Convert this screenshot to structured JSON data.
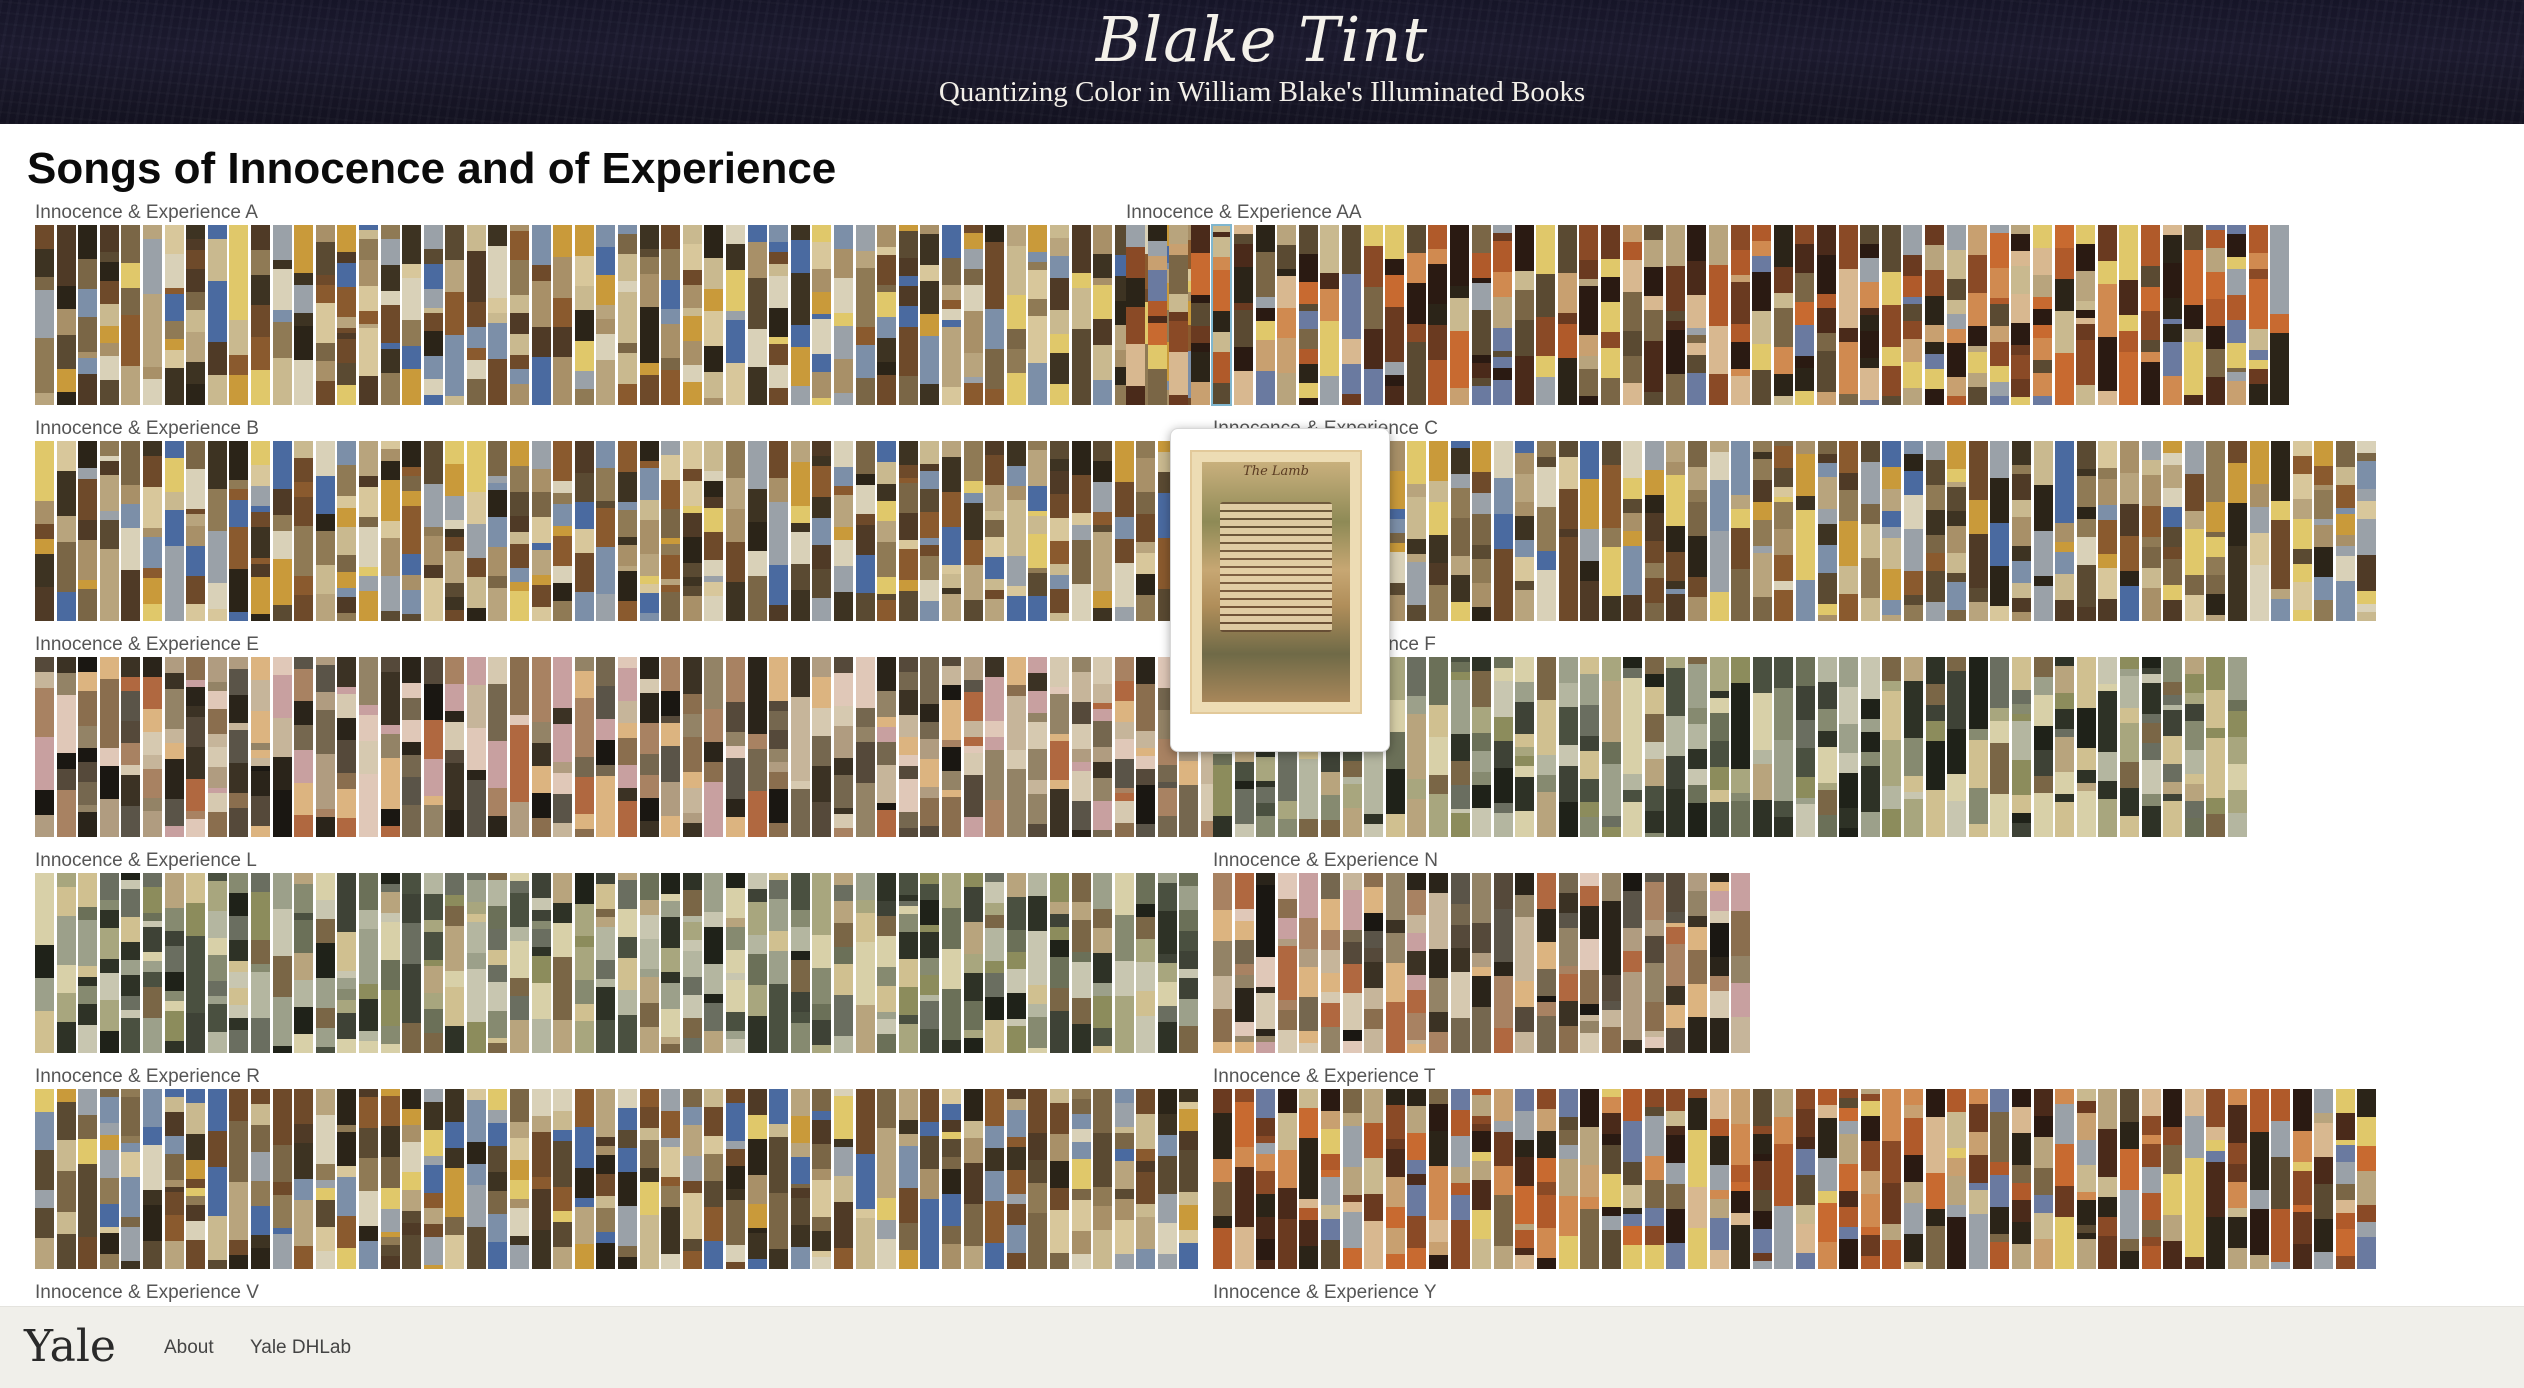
{
  "site": {
    "logo": "Blake Tint",
    "subtitle": "Quantizing Color in William Blake's Illuminated Books"
  },
  "page": {
    "title": "Songs of Innocence and of Experience"
  },
  "copies": [
    {
      "label": "Innocence & Experience A",
      "plates": 54
    },
    {
      "label": "Innocence & Experience AA",
      "plates": 54
    },
    {
      "label": "Innocence & Experience B",
      "plates": 54
    },
    {
      "label": "Innocence & Experience C",
      "plates": 54
    },
    {
      "label": "Innocence & Experience E",
      "plates": 55
    },
    {
      "label": "Innocence & Experience F",
      "plates": 48
    },
    {
      "label": "Innocence & Experience L",
      "plates": 54
    },
    {
      "label": "Innocence & Experience N",
      "plates": 25
    },
    {
      "label": "Innocence & Experience R",
      "plates": 54
    },
    {
      "label": "Innocence & Experience T",
      "plates": 54
    },
    {
      "label": "Innocence & Experience V",
      "plates": 0
    },
    {
      "label": "Innocence & Experience Y",
      "plates": 0
    }
  ],
  "popup": {
    "caption": "The Lamb"
  },
  "palette_families": {
    "warm": [
      "#2b2418",
      "#3d3322",
      "#5a4a32",
      "#7a6646",
      "#8f7a55",
      "#a89068",
      "#b8a47d",
      "#c9b98f",
      "#d8c79b",
      "#e0c86a",
      "#c99a3a",
      "#8a5a2e",
      "#6e4a2a",
      "#4f3a26",
      "#9aa1a8",
      "#7c8fa8",
      "#4a6aa0",
      "#d9d1b8"
    ],
    "sage": [
      "#1f2219",
      "#2e3226",
      "#4a5040",
      "#6b7058",
      "#868a70",
      "#9ca08a",
      "#b4b6a0",
      "#c8c6b0",
      "#a8a67e",
      "#8c8c5c",
      "#d8d0a8",
      "#6a6e60",
      "#3e4236",
      "#b8a47d",
      "#7a6646",
      "#d0c090"
    ],
    "dark": [
      "#1a1712",
      "#2a241a",
      "#3b3224",
      "#55493a",
      "#75674f",
      "#938366",
      "#b09c80",
      "#c6b59a",
      "#d6c9b0",
      "#8a6e4e",
      "#a88262",
      "#dcb480",
      "#b06840",
      "#c8a0a0",
      "#e0c8b8",
      "#5a5448"
    ],
    "rust": [
      "#2a1a12",
      "#4a2a1a",
      "#6a3a20",
      "#8a4a26",
      "#b05a2a",
      "#c86a30",
      "#d08a50",
      "#c8a070",
      "#d8b890",
      "#b8a47d",
      "#7a6646",
      "#5a4a32",
      "#9aa1a8",
      "#6a7aa0",
      "#e0c86a",
      "#2b2418",
      "#c9b98f"
    ]
  }
}
